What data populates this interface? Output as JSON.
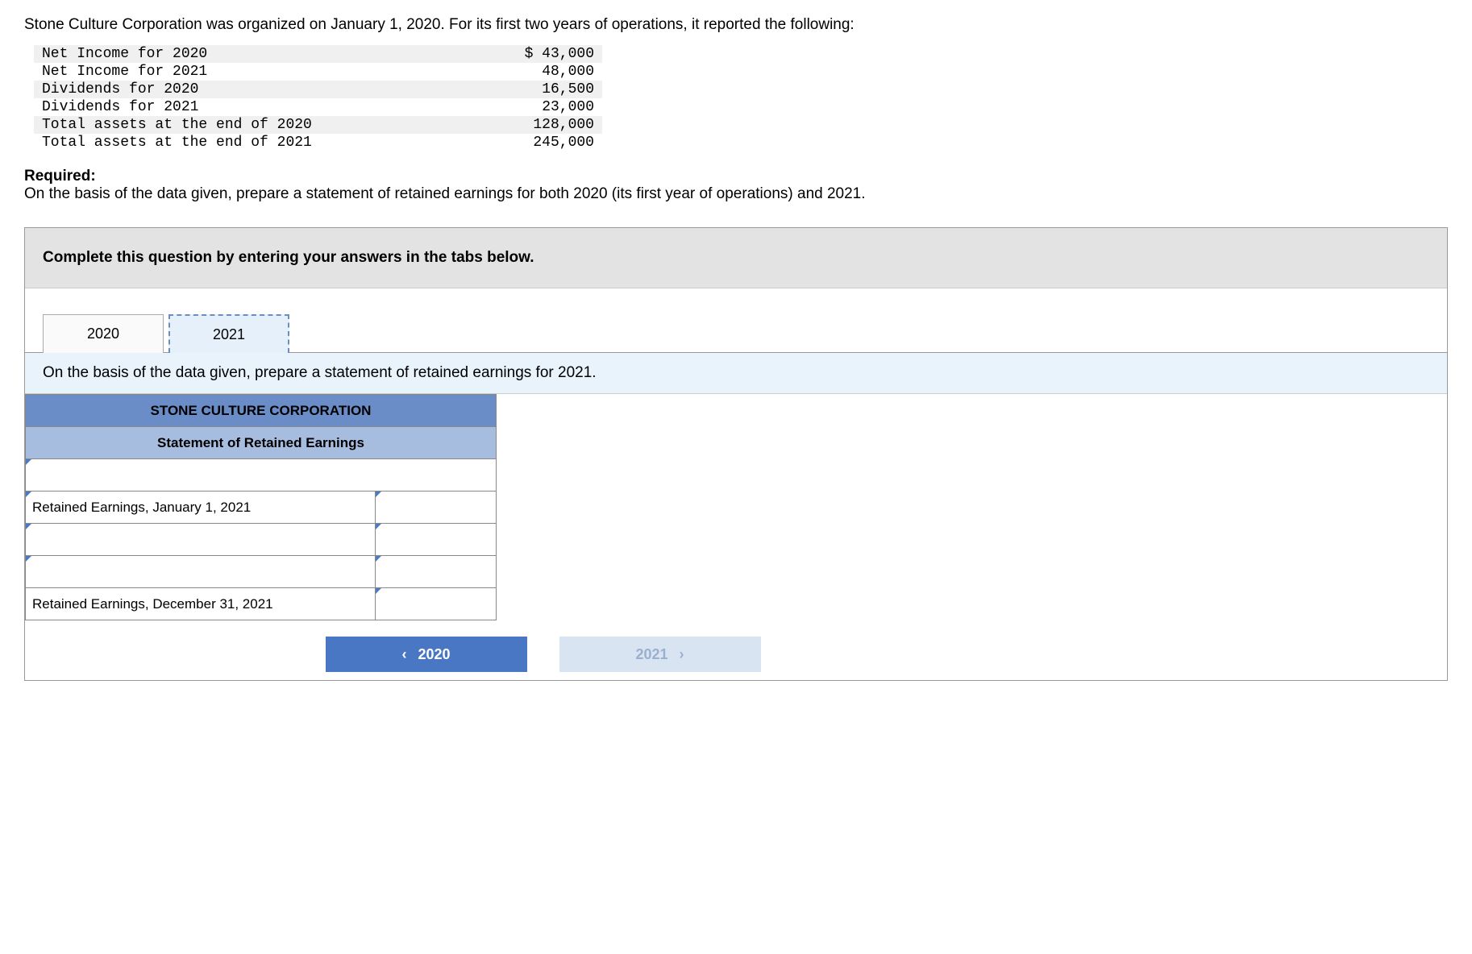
{
  "intro": "Stone Culture Corporation was organized on January 1, 2020. For its first two years of operations, it reported the following:",
  "data_rows": [
    {
      "label": "Net Income for 2020",
      "value": "$ 43,000"
    },
    {
      "label": "Net Income for 2021",
      "value": "48,000"
    },
    {
      "label": "Dividends for 2020",
      "value": "16,500"
    },
    {
      "label": "Dividends for 2021",
      "value": "23,000"
    },
    {
      "label": "Total assets at the end of 2020",
      "value": "128,000"
    },
    {
      "label": "Total assets at the end of 2021",
      "value": "245,000"
    }
  ],
  "required_label": "Required:",
  "required_text": "On the basis of the data given, prepare a statement of retained earnings for both 2020 (its first year of operations) and 2021.",
  "instruction": "Complete this question by entering your answers in the tabs below.",
  "tabs": {
    "y2020": "2020",
    "y2021": "2021"
  },
  "tab_content_header": "On the basis of the data given, prepare a statement of retained earnings for 2021.",
  "worksheet": {
    "company": "STONE CULTURE CORPORATION",
    "title": "Statement of Retained Earnings",
    "rows": {
      "date_row": "",
      "begin_label": "Retained Earnings, January 1, 2021",
      "blank1_label": "",
      "blank2_label": "",
      "end_label": "Retained Earnings, December 31, 2021",
      "begin_val": "",
      "blank1_val": "",
      "blank2_val": "",
      "end_val": ""
    }
  },
  "nav": {
    "prev": "2020",
    "next": "2021"
  }
}
